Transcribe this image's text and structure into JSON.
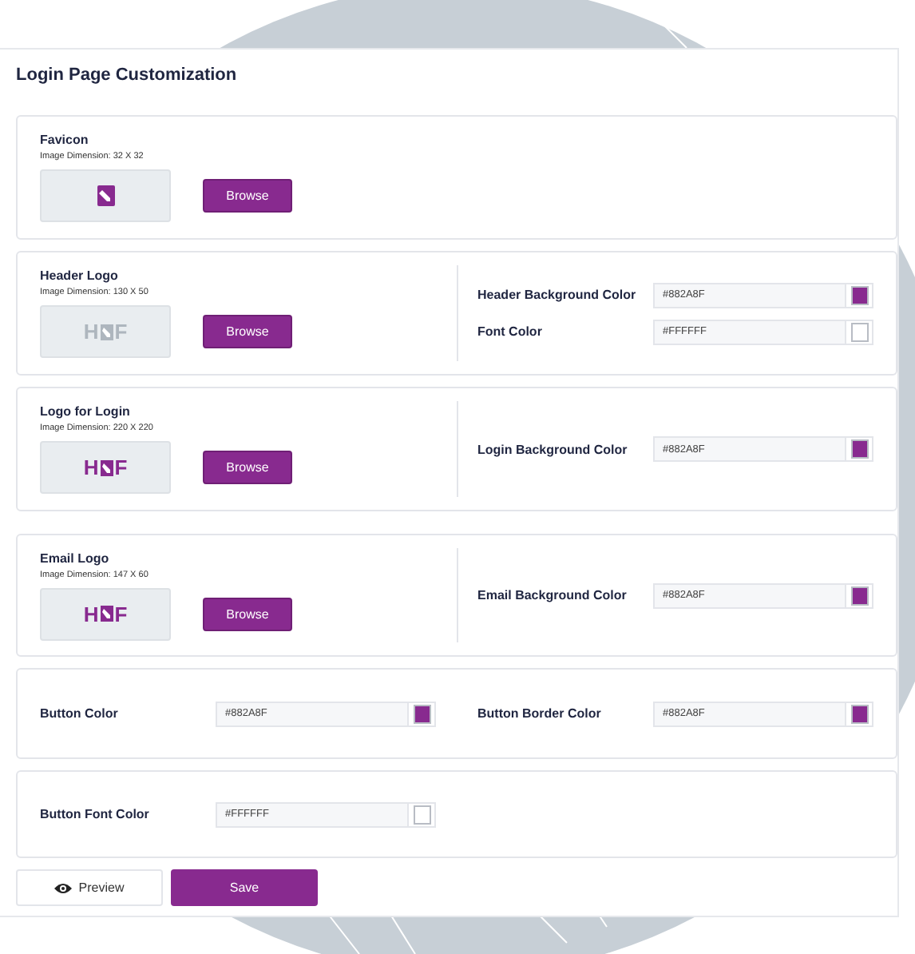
{
  "title": "Login Page Customization",
  "sections": [
    {
      "uploader": {
        "label": "Favicon",
        "dimension": "Image Dimension: 32 X 32",
        "preview": {
          "kind": "icon"
        },
        "button": "Browse"
      }
    },
    {
      "uploader": {
        "label": "Header Logo",
        "dimension": "Image Dimension: 130 X 50",
        "preview": {
          "kind": "logo",
          "left": "H",
          "right": "F",
          "color": "#aeb6be"
        },
        "button": "Browse"
      },
      "colors": [
        {
          "label": "Header Background Color",
          "value": "#882A8F",
          "color": "#882a8f"
        },
        {
          "label": "Font Color",
          "value": "#FFFFFF",
          "color": "#ffffff"
        }
      ]
    },
    {
      "uploader": {
        "label": "Logo for Login",
        "dimension": "Image Dimension: 220 X 220",
        "preview": {
          "kind": "logo",
          "left": "H",
          "right": "F",
          "color": "#882a8f"
        },
        "button": "Browse"
      },
      "colors": [
        {
          "label": "Login Background Color",
          "value": "#882A8F",
          "color": "#882a8f"
        }
      ]
    },
    {
      "uploader": {
        "label": "Email Logo",
        "dimension": "Image Dimension: 147 X 60",
        "preview": {
          "kind": "logo",
          "left": "H",
          "right": "F",
          "color": "#882a8f"
        },
        "button": "Browse"
      },
      "colors": [
        {
          "label": "Email Background Color",
          "value": "#882A8F",
          "color": "#882a8f"
        }
      ]
    },
    {
      "colors": [
        {
          "label": "Button Color",
          "value": "#882A8F",
          "color": "#882a8f"
        },
        {
          "label": "Button Border Color",
          "value": "#882A8F",
          "color": "#882a8f"
        }
      ]
    },
    {
      "colors": [
        {
          "label": "Button Font Color",
          "value": "#FFFFFF",
          "color": "#ffffff"
        }
      ]
    }
  ],
  "actions": {
    "preview": "Preview",
    "save": "Save"
  }
}
